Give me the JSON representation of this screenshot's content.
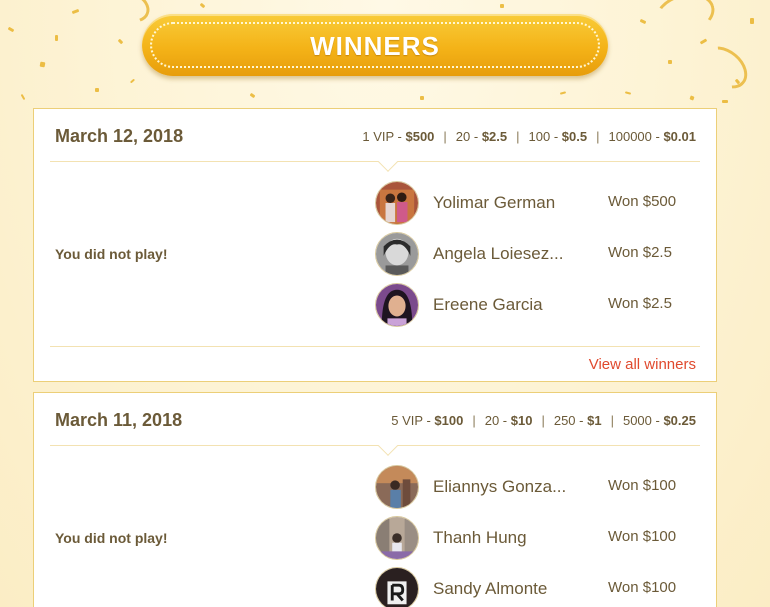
{
  "banner": {
    "title": "WINNERS"
  },
  "draws": [
    {
      "date": "March 12, 2018",
      "prizes": [
        {
          "count": "1 VIP",
          "amount": "$500"
        },
        {
          "count": "20",
          "amount": "$2.5"
        },
        {
          "count": "100",
          "amount": "$0.5"
        },
        {
          "count": "100000",
          "amount": "$0.01"
        }
      ],
      "status": "You did not play!",
      "winners": [
        {
          "name": "Yolimar German",
          "amount": "Won $500"
        },
        {
          "name": "Angela Loiesez...",
          "amount": "Won $2.5"
        },
        {
          "name": "Ereene Garcia",
          "amount": "Won $2.5"
        }
      ],
      "view_all": "View all winners"
    },
    {
      "date": "March 11, 2018",
      "prizes": [
        {
          "count": "5 VIP",
          "amount": "$100"
        },
        {
          "count": "20",
          "amount": "$10"
        },
        {
          "count": "250",
          "amount": "$1"
        },
        {
          "count": "5000",
          "amount": "$0.25"
        }
      ],
      "status": "You did not play!",
      "winners": [
        {
          "name": "Eliannys Gonza...",
          "amount": "Won $100"
        },
        {
          "name": "Thanh Hung",
          "amount": "Won $100"
        },
        {
          "name": "Sandy Almonte",
          "amount": "Won $100"
        }
      ]
    }
  ],
  "colors": {
    "accent": "#f4b318",
    "link": "#e04a2e",
    "text": "#6b5a38",
    "border": "#eccf78"
  }
}
